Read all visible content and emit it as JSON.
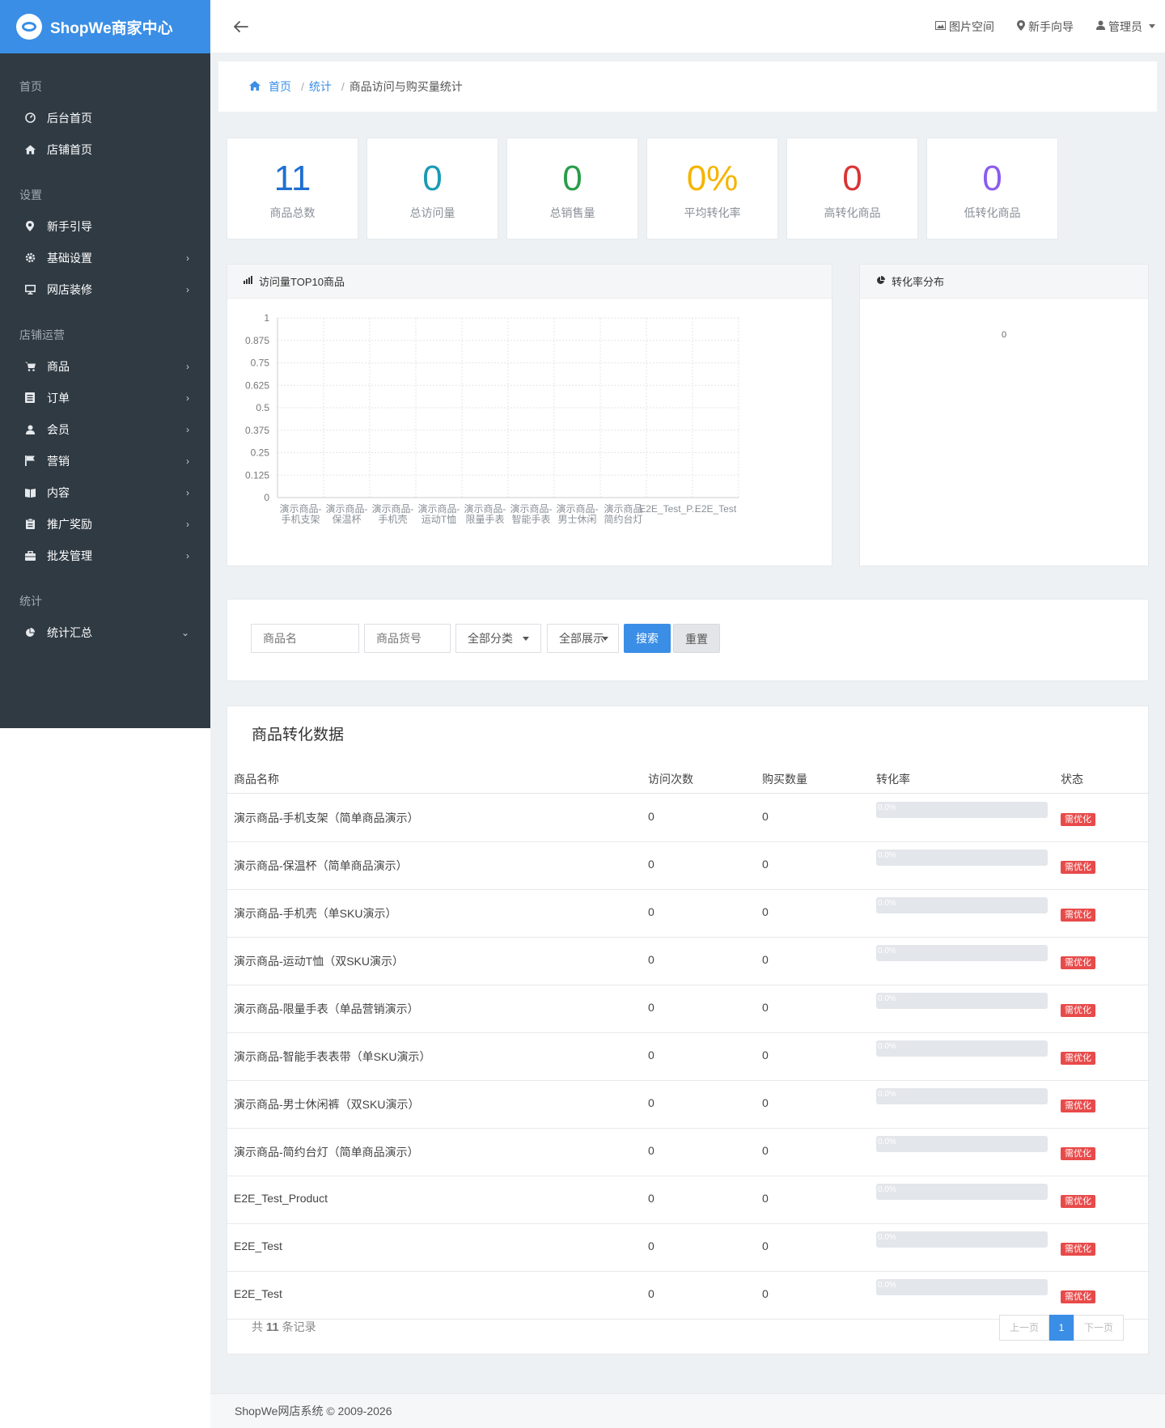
{
  "brand": {
    "title": "ShopWe商家中心"
  },
  "topbar": {
    "actions": [
      {
        "label": "图片空间",
        "icon": "image-icon"
      },
      {
        "label": "新手向导",
        "icon": "map-pin-icon"
      },
      {
        "label": "管理员",
        "icon": "user-icon"
      }
    ]
  },
  "sidebar": {
    "groups": [
      {
        "heading": "首页",
        "items": [
          {
            "label": "后台首页",
            "icon": "dashboard-icon",
            "arrow": ""
          },
          {
            "label": "店铺首页",
            "icon": "home-icon",
            "arrow": ""
          }
        ]
      },
      {
        "heading": "设置",
        "items": [
          {
            "label": "新手引导",
            "icon": "map-pin-icon",
            "arrow": ""
          },
          {
            "label": "基础设置",
            "icon": "gear-icon",
            "arrow": "›"
          },
          {
            "label": "网店装修",
            "icon": "monitor-icon",
            "arrow": "›"
          }
        ]
      },
      {
        "heading": "店铺运营",
        "items": [
          {
            "label": "商品",
            "icon": "cart-icon",
            "arrow": "›"
          },
          {
            "label": "订单",
            "icon": "list-icon",
            "arrow": "›"
          },
          {
            "label": "会员",
            "icon": "user-icon",
            "arrow": "›"
          },
          {
            "label": "营销",
            "icon": "flag-icon",
            "arrow": "›"
          },
          {
            "label": "内容",
            "icon": "book-icon",
            "arrow": "›"
          },
          {
            "label": "推广奖励",
            "icon": "clipboard-icon",
            "arrow": "›"
          },
          {
            "label": "批发管理",
            "icon": "briefcase-icon",
            "arrow": "›"
          }
        ]
      },
      {
        "heading": "统计",
        "items": [
          {
            "label": "统计汇总",
            "icon": "pie-chart-icon",
            "arrow": "⌄"
          }
        ]
      }
    ]
  },
  "breadcrumb": {
    "home": "首页",
    "section": "统计",
    "current": "商品访问与购买量统计"
  },
  "stats": [
    {
      "value": "11",
      "label": "商品总数",
      "color": "#1f6fd1"
    },
    {
      "value": "0",
      "label": "总访问量",
      "color": "#1a9bb3"
    },
    {
      "value": "0",
      "label": "总销售量",
      "color": "#2a9d4a"
    },
    {
      "value": "0%",
      "label": "平均转化率",
      "color": "#f5b400"
    },
    {
      "value": "0",
      "label": "高转化商品",
      "color": "#d93535"
    },
    {
      "value": "0",
      "label": "低转化商品",
      "color": "#8a5cf0"
    }
  ],
  "visits_panel": {
    "title": "访问量TOP10商品"
  },
  "conversion_panel": {
    "title": "转化率分布",
    "empty_value": "0"
  },
  "chart_data": {
    "type": "bar",
    "categories": [
      [
        "演示商品-",
        "手机支架"
      ],
      [
        "演示商品-",
        "保温杯"
      ],
      [
        "演示商品-",
        "手机壳"
      ],
      [
        "演示商品-",
        "运动T恤"
      ],
      [
        "演示商品-",
        "限量手表"
      ],
      [
        "演示商品-",
        "智能手表"
      ],
      [
        "演示商品-",
        "男士休闲"
      ],
      [
        "演示商品",
        "简约台灯"
      ],
      [
        "E2E_Test_P...",
        ""
      ],
      [
        "E2E_Test",
        ""
      ]
    ],
    "values": [
      0,
      0,
      0,
      0,
      0,
      0,
      0,
      0,
      0,
      0
    ],
    "yticks": [
      "0",
      "0.125",
      "0.25",
      "0.375",
      "0.5",
      "0.625",
      "0.75",
      "0.875",
      "1"
    ],
    "ylim": [
      0,
      1
    ],
    "grid": true
  },
  "search": {
    "name_placeholder": "商品名",
    "sku_placeholder": "商品货号",
    "category": "全部分类",
    "display": "全部展示",
    "search_label": "搜索",
    "reset_label": "重置"
  },
  "table": {
    "title": "商品转化数据",
    "headers": [
      "商品名称",
      "访问次数",
      "购买数量",
      "转化率",
      "状态"
    ],
    "rows": [
      {
        "name": "演示商品-手机支架（简单商品演示）",
        "visits": "0",
        "purchases": "0",
        "rate": "0.0%",
        "rate_value": 0,
        "status": "需优化"
      },
      {
        "name": "演示商品-保温杯（简单商品演示）",
        "visits": "0",
        "purchases": "0",
        "rate": "0.0%",
        "rate_value": 0,
        "status": "需优化"
      },
      {
        "name": "演示商品-手机壳（单SKU演示）",
        "visits": "0",
        "purchases": "0",
        "rate": "0.0%",
        "rate_value": 0,
        "status": "需优化"
      },
      {
        "name": "演示商品-运动T恤（双SKU演示）",
        "visits": "0",
        "purchases": "0",
        "rate": "0.0%",
        "rate_value": 0,
        "status": "需优化"
      },
      {
        "name": "演示商品-限量手表（单品营销演示）",
        "visits": "0",
        "purchases": "0",
        "rate": "0.0%",
        "rate_value": 0,
        "status": "需优化"
      },
      {
        "name": "演示商品-智能手表表带（单SKU演示）",
        "visits": "0",
        "purchases": "0",
        "rate": "0.0%",
        "rate_value": 0,
        "status": "需优化"
      },
      {
        "name": "演示商品-男士休闲裤（双SKU演示）",
        "visits": "0",
        "purchases": "0",
        "rate": "0.0%",
        "rate_value": 0,
        "status": "需优化"
      },
      {
        "name": "演示商品-简约台灯（简单商品演示）",
        "visits": "0",
        "purchases": "0",
        "rate": "0.0%",
        "rate_value": 0,
        "status": "需优化"
      },
      {
        "name": "E2E_Test_Product",
        "visits": "0",
        "purchases": "0",
        "rate": "0.0%",
        "rate_value": 0,
        "status": "需优化"
      },
      {
        "name": "E2E_Test",
        "visits": "0",
        "purchases": "0",
        "rate": "0.0%",
        "rate_value": 0,
        "status": "需优化"
      },
      {
        "name": "E2E_Test",
        "visits": "0",
        "purchases": "0",
        "rate": "0.0%",
        "rate_value": 0,
        "status": "需优化"
      }
    ],
    "total_prefix": "共",
    "total_count": "11",
    "total_suffix": "条记录",
    "pager": {
      "prev": "上一页",
      "current": "1",
      "next": "下一页"
    }
  },
  "footer": {
    "text": "ShopWe网店系统 © 2009-2026"
  }
}
